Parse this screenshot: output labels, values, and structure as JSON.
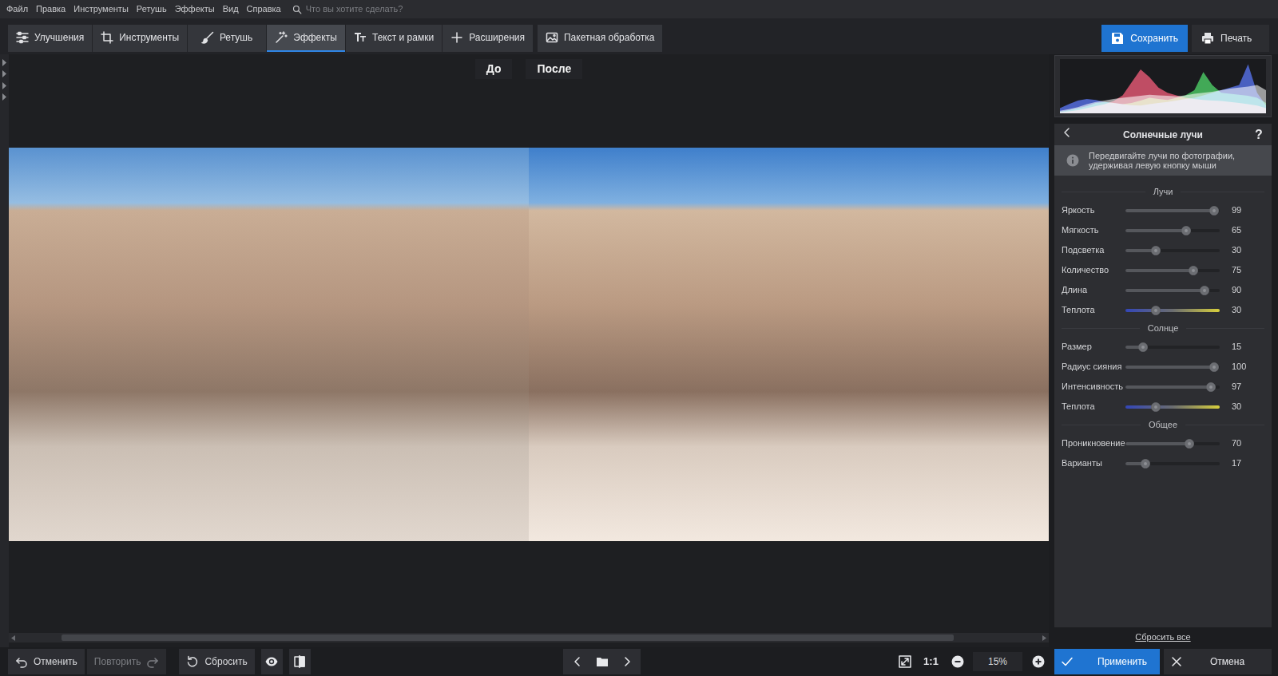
{
  "menu": [
    "Файл",
    "Правка",
    "Инструменты",
    "Ретушь",
    "Эффекты",
    "Вид",
    "Справка"
  ],
  "search": {
    "placeholder": "Что вы хотите сделать?"
  },
  "tabs": [
    {
      "label": "Улучшения",
      "selected": false
    },
    {
      "label": "Инструменты",
      "selected": false
    },
    {
      "label": "Ретушь",
      "selected": false
    },
    {
      "label": "Эффекты",
      "selected": true
    },
    {
      "label": "Текст и рамки",
      "selected": false
    },
    {
      "label": "Расширения",
      "selected": false
    }
  ],
  "batch": "Пакетная обработка",
  "save": "Сохранить",
  "print": "Печать",
  "compare": {
    "before": "До",
    "after": "После"
  },
  "histogram": {
    "series": [
      {
        "name": "luminance",
        "color": "#c8c8c8",
        "values": [
          5,
          8,
          12,
          18,
          22,
          25,
          28,
          30,
          32,
          34,
          36,
          35,
          34,
          33,
          35,
          38,
          40,
          42,
          45,
          48,
          50,
          52,
          55,
          45
        ]
      },
      {
        "name": "red",
        "color": "#ff4d6d",
        "values": [
          2,
          4,
          6,
          10,
          14,
          18,
          24,
          35,
          60,
          85,
          70,
          50,
          40,
          35,
          30,
          28,
          26,
          25,
          24,
          22,
          20,
          18,
          15,
          10
        ]
      },
      {
        "name": "green",
        "color": "#3fdc5a",
        "values": [
          3,
          6,
          10,
          14,
          20,
          22,
          20,
          18,
          20,
          25,
          30,
          28,
          26,
          30,
          35,
          45,
          80,
          55,
          40,
          38,
          36,
          34,
          30,
          20
        ]
      },
      {
        "name": "blue",
        "color": "#4a6bff",
        "values": [
          10,
          18,
          25,
          28,
          26,
          22,
          20,
          18,
          16,
          15,
          18,
          20,
          22,
          25,
          28,
          30,
          35,
          40,
          45,
          50,
          55,
          95,
          40,
          15
        ]
      }
    ]
  },
  "panel": {
    "title": "Солнечные лучи",
    "help": "?",
    "info_lines": [
      "Передвигайте лучи по фотографии,",
      "удерживая левую кнопку мыши"
    ],
    "sections": [
      {
        "title": "Лучи",
        "sliders": [
          {
            "label": "Яркость",
            "value": "99",
            "level": 0.94,
            "kind": "plain"
          },
          {
            "label": "Мягкость",
            "value": "65",
            "level": 0.64,
            "kind": "plain"
          },
          {
            "label": "Подсветка",
            "value": "30",
            "level": 0.32,
            "kind": "plain"
          },
          {
            "label": "Количество",
            "value": "75",
            "level": 0.72,
            "kind": "plain"
          },
          {
            "label": "Длина",
            "value": "90",
            "level": 0.84,
            "kind": "plain"
          },
          {
            "label": "Теплота",
            "value": "30",
            "level": 0.32,
            "kind": "warmth"
          }
        ]
      },
      {
        "title": "Солнце",
        "sliders": [
          {
            "label": "Размер",
            "value": "15",
            "level": 0.19,
            "kind": "plain"
          },
          {
            "label": "Радиус сияния",
            "value": "100",
            "level": 0.94,
            "kind": "plain"
          },
          {
            "label": "Интенсивность",
            "value": "97",
            "level": 0.91,
            "kind": "plain"
          },
          {
            "label": "Теплота",
            "value": "30",
            "level": 0.32,
            "kind": "warmth"
          }
        ]
      },
      {
        "title": "Общее",
        "sliders": [
          {
            "label": "Проникновение",
            "value": "70",
            "level": 0.68,
            "kind": "plain"
          },
          {
            "label": "Варианты",
            "value": "17",
            "level": 0.21,
            "kind": "plain"
          }
        ]
      }
    ]
  },
  "reset_all": "Сбросить все",
  "apply": "Применить",
  "cancel": "Отмена",
  "bottom": {
    "undo": {
      "label": "Отменить",
      "disabled": false
    },
    "redo": {
      "label": "Повторить",
      "disabled": true
    },
    "reset": "Сбросить",
    "one_to_one": "1:1",
    "zoom": "15%"
  }
}
